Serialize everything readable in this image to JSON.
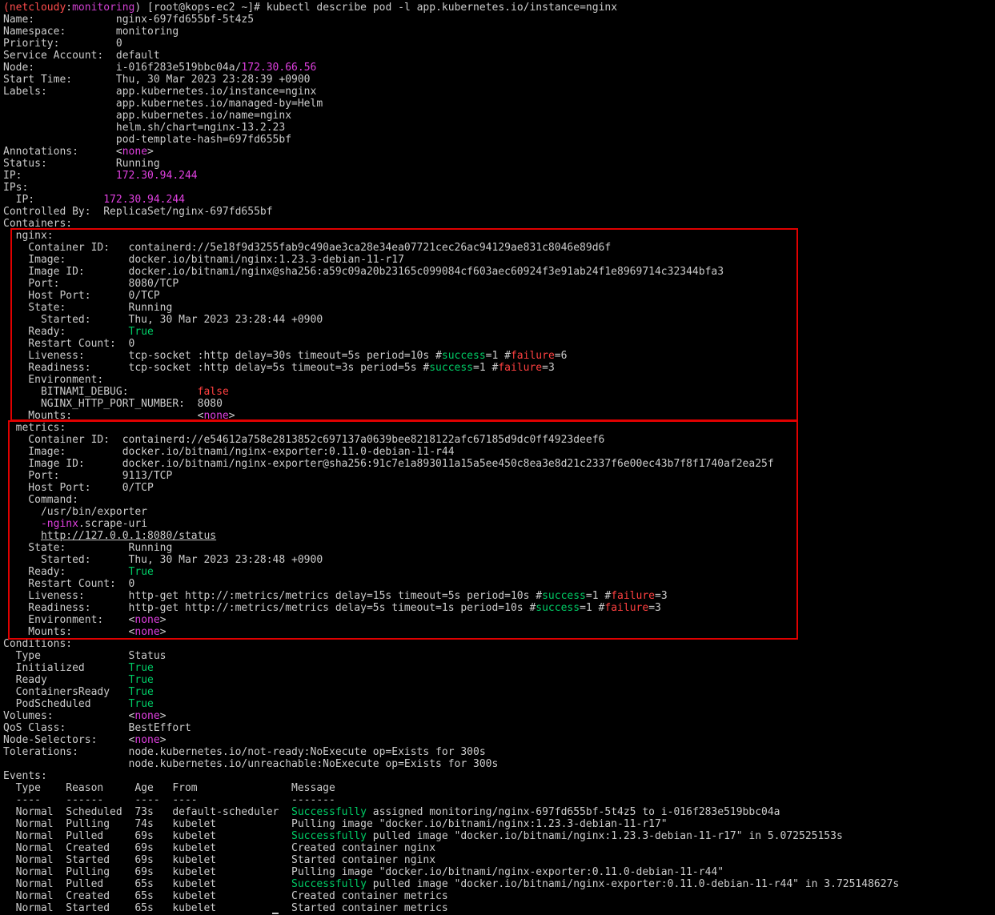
{
  "prompt": {
    "open_paren": "(",
    "user": "netcloudy",
    "colon": ":",
    "context": "monitoring",
    "rest": ") [root@kops-ec2 ~]# ",
    "command": "kubectl describe pod -l app.kubernetes.io/instance=nginx"
  },
  "lines": [
    [
      {
        "t": "Name:             nginx-697fd655bf-5t4z5"
      }
    ],
    [
      {
        "t": "Namespace:        monitoring"
      }
    ],
    [
      {
        "t": "Priority:         0"
      }
    ],
    [
      {
        "t": "Service Account:  default"
      }
    ],
    [
      {
        "t": "Node:             i-016f283e519bbc04a/"
      },
      {
        "t": "172.30.66.56",
        "c": "mag"
      }
    ],
    [
      {
        "t": "Start Time:       Thu, 30 Mar 2023 23:28:39 +0900"
      }
    ],
    [
      {
        "t": "Labels:           app.kubernetes.io/instance=nginx"
      }
    ],
    [
      {
        "t": "                  app.kubernetes.io/managed-by=Helm"
      }
    ],
    [
      {
        "t": "                  app.kubernetes.io/name=nginx"
      }
    ],
    [
      {
        "t": "                  helm.sh/chart=nginx-13.2.23"
      }
    ],
    [
      {
        "t": "                  pod-template-hash=697fd655bf"
      }
    ],
    [
      {
        "t": "Annotations:      <"
      },
      {
        "t": "none",
        "c": "mag"
      },
      {
        "t": ">"
      }
    ],
    [
      {
        "t": "Status:           Running"
      }
    ],
    [
      {
        "t": "IP:               "
      },
      {
        "t": "172.30.94.244",
        "c": "mag"
      }
    ],
    [
      {
        "t": "IPs:"
      }
    ],
    [
      {
        "t": "  IP:           "
      },
      {
        "t": "172.30.94.244",
        "c": "mag"
      }
    ],
    [
      {
        "t": "Controlled By:  ReplicaSet/nginx-697fd655bf"
      }
    ],
    [
      {
        "t": "Containers:"
      }
    ],
    [
      {
        "t": "  nginx:"
      }
    ],
    [
      {
        "t": "    Container ID:   containerd://5e18f9d3255fab9c490ae3ca28e34ea07721cec26ac94129ae831c8046e89d6f"
      }
    ],
    [
      {
        "t": "    Image:          docker.io/bitnami/nginx:1.23.3-debian-11-r17"
      }
    ],
    [
      {
        "t": "    Image ID:       docker.io/bitnami/nginx@sha256:a59c09a20b23165c099084cf603aec60924f3e91ab24f1e8969714c32344bfa3"
      }
    ],
    [
      {
        "t": "    Port:           8080/TCP"
      }
    ],
    [
      {
        "t": "    Host Port:      0/TCP"
      }
    ],
    [
      {
        "t": "    State:          Running"
      }
    ],
    [
      {
        "t": "      Started:      Thu, 30 Mar 2023 23:28:44 +0900"
      }
    ],
    [
      {
        "t": "    Ready:          "
      },
      {
        "t": "True",
        "c": "grn"
      }
    ],
    [
      {
        "t": "    Restart Count:  0"
      }
    ],
    [
      {
        "t": "    Liveness:       tcp-socket :http delay=30s timeout=5s period=10s #"
      },
      {
        "t": "success",
        "c": "grn"
      },
      {
        "t": "=1 #"
      },
      {
        "t": "failure",
        "c": "red"
      },
      {
        "t": "=6"
      }
    ],
    [
      {
        "t": "    Readiness:      tcp-socket :http delay=5s timeout=3s period=5s #"
      },
      {
        "t": "success",
        "c": "grn"
      },
      {
        "t": "=1 #"
      },
      {
        "t": "failure",
        "c": "red"
      },
      {
        "t": "=3"
      }
    ],
    [
      {
        "t": "    Environment:"
      }
    ],
    [
      {
        "t": "      BITNAMI_DEBUG:           "
      },
      {
        "t": "false",
        "c": "red"
      }
    ],
    [
      {
        "t": "      NGINX_HTTP_PORT_NUMBER:  8080"
      }
    ],
    [
      {
        "t": "    Mounts:                    <"
      },
      {
        "t": "none",
        "c": "mag"
      },
      {
        "t": ">"
      }
    ],
    [
      {
        "t": "  metrics:"
      }
    ],
    [
      {
        "t": "    Container ID:  containerd://e54612a758e2813852c697137a0639bee8218122afc67185d9dc0ff4923deef6"
      }
    ],
    [
      {
        "t": "    Image:         docker.io/bitnami/nginx-exporter:0.11.0-debian-11-r44"
      }
    ],
    [
      {
        "t": "    Image ID:      docker.io/bitnami/nginx-exporter@sha256:91c7e1a893011a15a5ee450c8ea3e8d21c2337f6e00ec43b7f8f1740af2ea25f"
      }
    ],
    [
      {
        "t": "    Port:          9113/TCP"
      }
    ],
    [
      {
        "t": "    Host Port:     0/TCP"
      }
    ],
    [
      {
        "t": "    Command:"
      }
    ],
    [
      {
        "t": "      /usr/bin/exporter"
      }
    ],
    [
      {
        "t": "      "
      },
      {
        "t": "-nginx",
        "c": "mag"
      },
      {
        "t": ".scrape-uri"
      }
    ],
    [
      {
        "t": "      "
      },
      {
        "t": "http://127.0.0.1:8080/status",
        "c": "link"
      }
    ],
    [
      {
        "t": "    State:          Running"
      }
    ],
    [
      {
        "t": "      Started:      Thu, 30 Mar 2023 23:28:48 +0900"
      }
    ],
    [
      {
        "t": "    Ready:          "
      },
      {
        "t": "True",
        "c": "grn"
      }
    ],
    [
      {
        "t": "    Restart Count:  0"
      }
    ],
    [
      {
        "t": "    Liveness:       http-get http://:metrics/metrics delay=15s timeout=5s period=10s #"
      },
      {
        "t": "success",
        "c": "grn"
      },
      {
        "t": "=1 #"
      },
      {
        "t": "failure",
        "c": "red"
      },
      {
        "t": "=3"
      }
    ],
    [
      {
        "t": "    Readiness:      http-get http://:metrics/metrics delay=5s timeout=1s period=10s #"
      },
      {
        "t": "success",
        "c": "grn"
      },
      {
        "t": "=1 #"
      },
      {
        "t": "failure",
        "c": "red"
      },
      {
        "t": "=3"
      }
    ],
    [
      {
        "t": "    Environment:    <"
      },
      {
        "t": "none",
        "c": "mag"
      },
      {
        "t": ">"
      }
    ],
    [
      {
        "t": "    Mounts:         <"
      },
      {
        "t": "none",
        "c": "mag"
      },
      {
        "t": ">"
      }
    ],
    [
      {
        "t": "Conditions:"
      }
    ],
    [
      {
        "t": "  Type              Status"
      }
    ],
    [
      {
        "t": "  Initialized       "
      },
      {
        "t": "True",
        "c": "grn"
      }
    ],
    [
      {
        "t": "  Ready             "
      },
      {
        "t": "True",
        "c": "grn"
      }
    ],
    [
      {
        "t": "  ContainersReady   "
      },
      {
        "t": "True",
        "c": "grn"
      }
    ],
    [
      {
        "t": "  PodScheduled      "
      },
      {
        "t": "True",
        "c": "grn"
      }
    ],
    [
      {
        "t": "Volumes:            <"
      },
      {
        "t": "none",
        "c": "mag"
      },
      {
        "t": ">"
      }
    ],
    [
      {
        "t": "QoS Class:          BestEffort"
      }
    ],
    [
      {
        "t": "Node-Selectors:     <"
      },
      {
        "t": "none",
        "c": "mag"
      },
      {
        "t": ">"
      }
    ],
    [
      {
        "t": "Tolerations:        node.kubernetes.io/not-ready:NoExecute op=Exists for 300s"
      }
    ],
    [
      {
        "t": "                    node.kubernetes.io/unreachable:NoExecute op=Exists for 300s"
      }
    ],
    [
      {
        "t": "Events:"
      }
    ],
    [
      {
        "t": "  Type    Reason     Age   From               Message"
      }
    ],
    [
      {
        "t": "  ----    ------     ----  ----               -------"
      }
    ],
    [
      {
        "t": "  Normal  Scheduled  73s   default-scheduler  "
      },
      {
        "t": "Successfully",
        "c": "grn"
      },
      {
        "t": " assigned monitoring/nginx-697fd655bf-5t4z5 to i-016f283e519bbc04a"
      }
    ],
    [
      {
        "t": "  Normal  Pulling    74s   kubelet            Pulling image \"docker.io/bitnami/nginx:1.23.3-debian-11-r17\""
      }
    ],
    [
      {
        "t": "  Normal  Pulled     69s   kubelet            "
      },
      {
        "t": "Successfully",
        "c": "grn"
      },
      {
        "t": " pulled image \"docker.io/bitnami/nginx:1.23.3-debian-11-r17\" in 5.072525153s"
      }
    ],
    [
      {
        "t": "  Normal  Created    69s   kubelet            Created container nginx"
      }
    ],
    [
      {
        "t": "  Normal  Started    69s   kubelet            Started container nginx"
      }
    ],
    [
      {
        "t": "  Normal  Pulling    69s   kubelet            Pulling image \"docker.io/bitnami/nginx-exporter:0.11.0-debian-11-r44\""
      }
    ],
    [
      {
        "t": "  Normal  Pulled     65s   kubelet            "
      },
      {
        "t": "Successfully",
        "c": "grn"
      },
      {
        "t": " pulled image \"docker.io/bitnami/nginx-exporter:0.11.0-debian-11-r44\" in 3.725148627s"
      }
    ],
    [
      {
        "t": "  Normal  Created    65s   kubelet            Created container metrics"
      }
    ],
    [
      {
        "t": "  Normal  Started    65s   kubelet            Started container metrics"
      }
    ]
  ],
  "colors": {
    "background": "#000000",
    "text": "#cccccc",
    "ip_and_none": "#e040e0",
    "true_success": "#00cc66",
    "failure_false": "#ff4040",
    "highlight_box": "#e00000"
  }
}
